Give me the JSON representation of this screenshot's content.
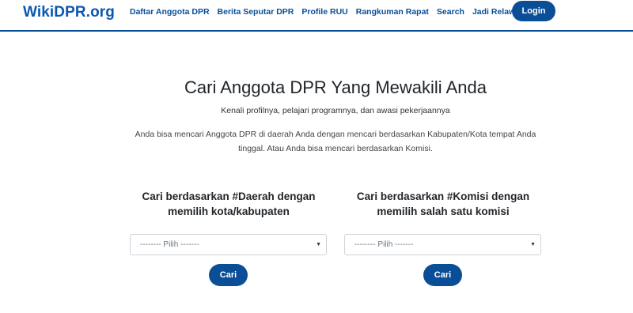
{
  "navbar": {
    "brand_prefix": "Wiki",
    "brand_main": "DPR.org",
    "links": [
      {
        "label": "Daftar Anggota DPR"
      },
      {
        "label": "Berita Seputar DPR"
      },
      {
        "label": "Profile RUU"
      },
      {
        "label": "Rangkuman Rapat"
      },
      {
        "label": "Search"
      },
      {
        "label": "Jadi Relawan"
      }
    ],
    "login_label": "Login"
  },
  "hero": {
    "title": "Cari Anggota DPR Yang Mewakili Anda",
    "subtitle": "Kenali profilnya, pelajari programnya, dan awasi pekerjaannya",
    "description": "Anda bisa mencari Anggota DPR di daerah Anda dengan mencari berdasarkan Kabupaten/Kota tempat Anda tinggal. Atau Anda bisa mencari berdasarkan Komisi."
  },
  "search_region": {
    "heading": "Cari berdasarkan #Daerah dengan memilih kota/kabupaten",
    "select_value": "-------- Pilih -------",
    "button_label": "Cari"
  },
  "search_commission": {
    "heading": "Cari berdasarkan #Komisi dengan memilih salah satu komisi",
    "select_value": "-------- Pilih -------",
    "button_label": "Cari"
  },
  "colors": {
    "brand": "#0a57b0",
    "primary": "#0a4e98"
  },
  "icons": {
    "select_arrow": "caret-down-icon"
  }
}
